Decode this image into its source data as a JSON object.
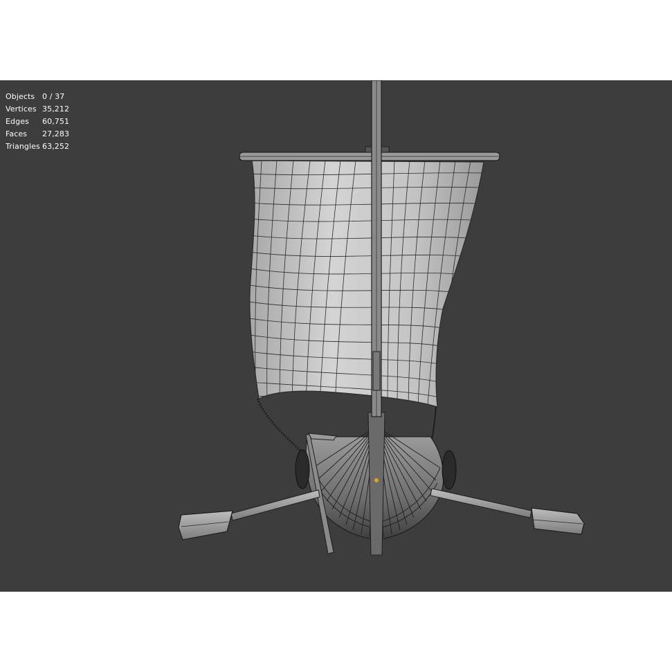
{
  "stats": [
    {
      "label": "Objects",
      "value": "0 / 37"
    },
    {
      "label": "Vertices",
      "value": "35,212"
    },
    {
      "label": "Edges",
      "value": "60,751"
    },
    {
      "label": "Faces",
      "value": "27,283"
    },
    {
      "label": "Triangles",
      "value": "63,252"
    }
  ],
  "colors": {
    "viewport_bg": "#3d3d3d",
    "page_bg": "#ffffff",
    "stats_text": "#ffffff",
    "wire": "#2a2a2a",
    "sail_fill": "#c8c8c8",
    "hull_fill": "#7a7a7a",
    "origin_dot": "#e8a020"
  },
  "icons": {
    "model": "viking-ship-wireframe"
  }
}
